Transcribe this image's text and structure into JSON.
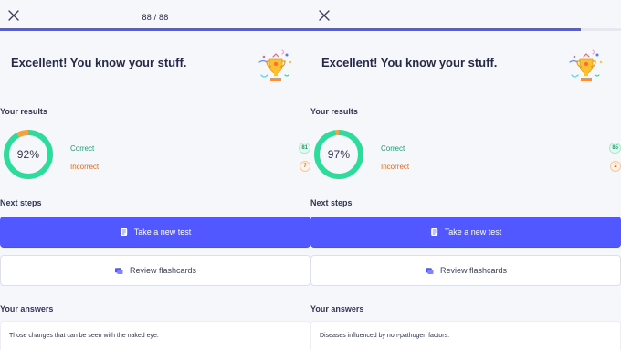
{
  "left": {
    "close": "×",
    "counter": "88 / 88",
    "progress": 1,
    "title": "Excellent! You know your stuff.",
    "results_label": "Your results",
    "percent": "92%",
    "correct_label": "Correct",
    "correct_count": "81",
    "incorrect_label": "Incorrect",
    "incorrect_count": "7",
    "next_steps_label": "Next steps",
    "primary_button": "Take a new test",
    "secondary_button": "Review flashcards",
    "answers_label": "Your answers",
    "answer_text": "Those changes that can be seen with the naked eye."
  },
  "right": {
    "close": "×",
    "counter": "",
    "progress": 0.87,
    "title": "Excellent! You know your stuff.",
    "results_label": "Your results",
    "percent": "97%",
    "correct_label": "Correct",
    "correct_count": "85",
    "incorrect_label": "Incorrect",
    "incorrect_count": "2",
    "next_steps_label": "Next steps",
    "primary_button": "Take a new test",
    "secondary_button": "Review flashcards",
    "answers_label": "Your answers",
    "answer_text": "Diseases influenced by non-pathogen factors."
  },
  "colors": {
    "accent": "#4F58FF",
    "success": "#2DDC9A",
    "warning": "#F3A23E"
  },
  "icons": {
    "close": "close-icon",
    "trophy": "trophy-icon",
    "test": "test-icon",
    "flashcards": "flashcards-icon"
  }
}
